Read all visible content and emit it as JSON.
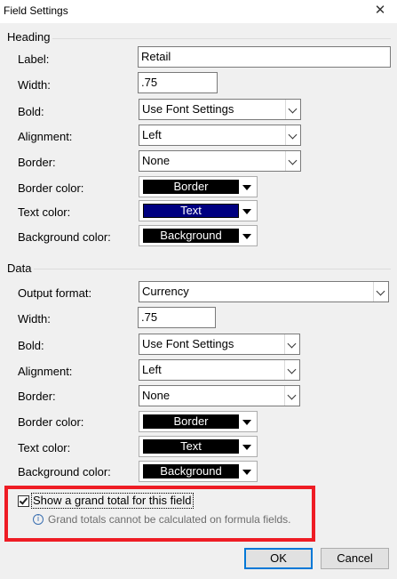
{
  "window": {
    "title": "Field Settings",
    "close_glyph": "✕"
  },
  "heading": {
    "group_label": "Heading",
    "label_caption": "Label:",
    "label_value": "Retail",
    "width_caption": "Width:",
    "width_value": ".75",
    "bold_caption": "Bold:",
    "bold_value": "Use Font Settings",
    "alignment_caption": "Alignment:",
    "alignment_value": "Left",
    "border_caption": "Border:",
    "border_value": "None",
    "border_color_caption": "Border color:",
    "border_color_text": "Border",
    "border_color_hex": "#000000",
    "text_color_caption": "Text color:",
    "text_color_text": "Text",
    "text_color_hex": "#000080",
    "bg_color_caption": "Background color:",
    "bg_color_text": "Background",
    "bg_color_hex": "#000000"
  },
  "data": {
    "group_label": "Data",
    "output_format_caption": "Output format:",
    "output_format_value": "Currency",
    "width_caption": "Width:",
    "width_value": ".75",
    "bold_caption": "Bold:",
    "bold_value": "Use Font Settings",
    "alignment_caption": "Alignment:",
    "alignment_value": "Left",
    "border_caption": "Border:",
    "border_value": "None",
    "border_color_caption": "Border color:",
    "border_color_text": "Border",
    "border_color_hex": "#000000",
    "text_color_caption": "Text color:",
    "text_color_text": "Text",
    "text_color_hex": "#000000",
    "bg_color_caption": "Background color:",
    "bg_color_text": "Background",
    "bg_color_hex": "#000000"
  },
  "grand_total": {
    "checkbox_label": "Show a grand total for this field",
    "checked": true,
    "info_text": "Grand totals cannot be calculated on formula fields.",
    "highlight_color": "#ee1c24"
  },
  "buttons": {
    "ok": "OK",
    "cancel": "Cancel"
  }
}
